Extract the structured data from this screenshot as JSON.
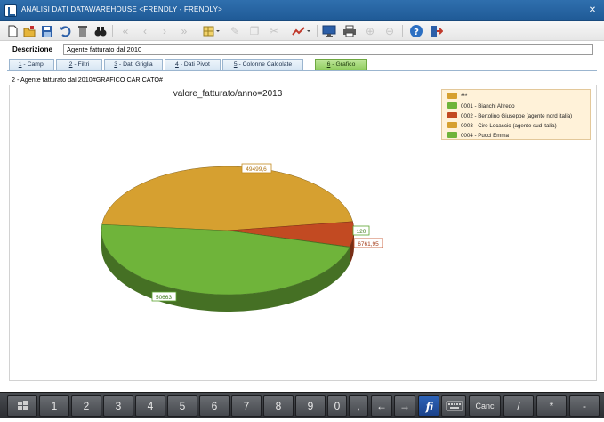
{
  "window": {
    "title": "ANALISI DATI DATAWAREHOUSE <FRENDLY - FRENDLY>",
    "close_glyph": "✕"
  },
  "toolbar": {
    "icons": [
      "new-icon",
      "open-folder-icon",
      "save-icon",
      "undo-icon",
      "delete-icon",
      "binoculars-icon",
      "first-icon",
      "previous-icon",
      "next-icon",
      "last-icon",
      "grid-dropdown-icon",
      "edit-icon",
      "copy-icon",
      "paste-icon",
      "chart-dropdown-icon",
      "monitor-icon",
      "print-icon",
      "zoom-in-icon",
      "zoom-out-icon",
      "help-icon",
      "exit-icon"
    ]
  },
  "description": {
    "label": "Descrizione",
    "value": "Agente fatturato dal 2010"
  },
  "tabs": [
    {
      "num": "1",
      "label": " - Campi"
    },
    {
      "num": "2",
      "label": " - Filtri"
    },
    {
      "num": "3",
      "label": " - Dati Griglia"
    },
    {
      "num": "4",
      "label": " - Dati Pivot"
    },
    {
      "num": "5",
      "label": " - Colonne Calcolate"
    },
    {
      "num": "6",
      "label": " - Grafico"
    }
  ],
  "active_tab": 5,
  "status": "2 - Agente fatturato dal 2010#GRAFICO CARICATO#",
  "chart_data": {
    "type": "pie",
    "title": "valore_fatturato/anno=2013",
    "style": "3d",
    "legend_position": "top-right",
    "slices": [
      {
        "name": "***",
        "value": null,
        "color": "#d6a030"
      },
      {
        "name": "0001 - Bianchi Alfredo",
        "value": 50663,
        "color": "#6fb43a"
      },
      {
        "name": "0002 - Bertolino Giuseppe (agente nord italia)",
        "value": 6761.95,
        "color": "#c24a22"
      },
      {
        "name": "0003 - Ciro Locascio (agente sud italia)",
        "value": 49499.6,
        "color": "#d6a030"
      },
      {
        "name": "0004 - Pucci Emma",
        "value": 120,
        "color": "#6fb43a"
      }
    ],
    "labels": {
      "top": "49499,6",
      "bottom": "50663",
      "right_small": "120",
      "right": "6761,95"
    }
  },
  "keypad": {
    "keys": [
      "1",
      "2",
      "3",
      "4",
      "5",
      "6",
      "7",
      "8",
      "9",
      "0",
      ",",
      "←",
      "→",
      "Canc",
      "/",
      "*",
      "-"
    ]
  },
  "colors": {
    "titlebar": "#2f6fae",
    "tab_active": "#8dcb5c",
    "keypad_bg": "#3a3c40"
  }
}
